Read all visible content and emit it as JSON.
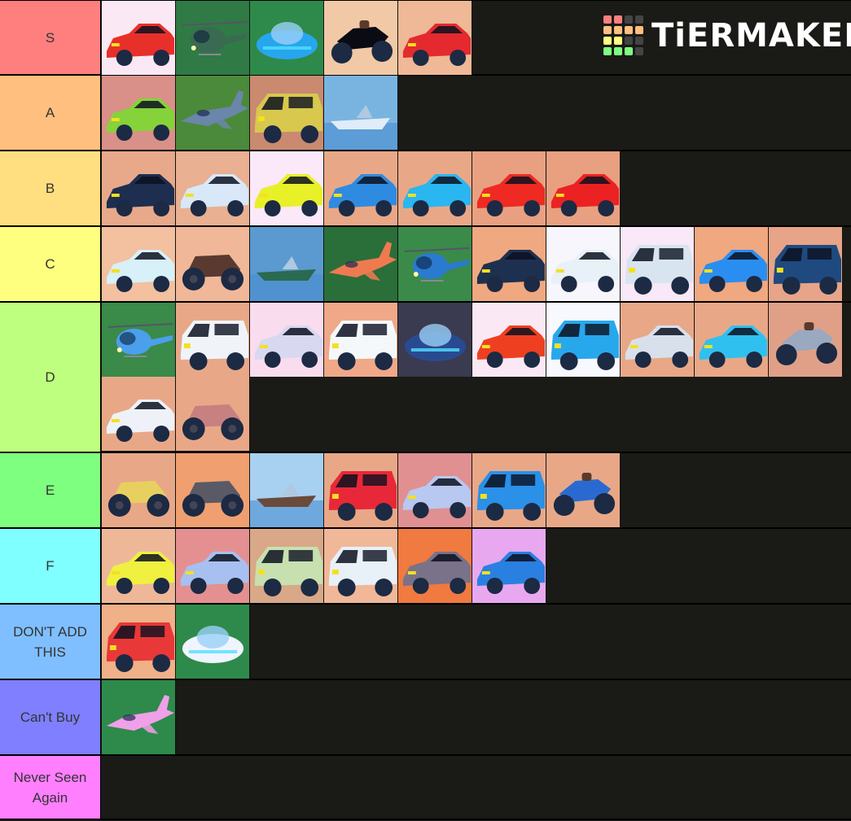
{
  "logo": {
    "text": "TiERMAKER",
    "grid_colors": [
      "#ff7f7f",
      "#ff7f7f",
      "#444444",
      "#444444",
      "#ffbf7f",
      "#ffbf7f",
      "#ffbf7f",
      "#ffbf7f",
      "#ffff7f",
      "#ffff7f",
      "#444444",
      "#444444",
      "#7fff7f",
      "#7fff7f",
      "#7fff7f",
      "#444444"
    ]
  },
  "tiers": [
    {
      "label": "S",
      "color": "#ff7f7f",
      "items": [
        {
          "name": "red-sports-car",
          "bg": "#fbe8f5",
          "body": "#e8302a",
          "kind": "car"
        },
        {
          "name": "military-helicopter",
          "bg": "#2f7a45",
          "body": "#3a6a52",
          "kind": "heli"
        },
        {
          "name": "blue-hover-vehicle",
          "bg": "#2e8a4a",
          "body": "#27a6ee",
          "kind": "hover"
        },
        {
          "name": "black-motorcycle",
          "bg": "#f2c9a6",
          "body": "#0b0b14",
          "kind": "bike"
        },
        {
          "name": "red-supercar",
          "bg": "#efb896",
          "body": "#e42a2e",
          "kind": "car"
        }
      ]
    },
    {
      "label": "A",
      "color": "#ffbf7f",
      "items": [
        {
          "name": "green-hypercar",
          "bg": "#d99088",
          "body": "#86d23a",
          "kind": "car"
        },
        {
          "name": "fighter-jet",
          "bg": "#4b8a3a",
          "body": "#6a86a8",
          "kind": "jet"
        },
        {
          "name": "yellow-suv",
          "bg": "#c98a70",
          "body": "#d8c84e",
          "kind": "suv"
        },
        {
          "name": "jet-ski",
          "bg": "#79b4e0",
          "body": "#e0ecf8",
          "kind": "boat"
        }
      ]
    },
    {
      "label": "B",
      "color": "#ffdf7f",
      "items": [
        {
          "name": "dark-blue-batmobile",
          "bg": "#e7a98a",
          "body": "#1e2e50",
          "kind": "car"
        },
        {
          "name": "classic-white-coupe",
          "bg": "#e9b092",
          "body": "#d8e8f8",
          "kind": "car"
        },
        {
          "name": "yellow-lamborghini",
          "bg": "#fbe8f8",
          "body": "#e8f028",
          "kind": "car"
        },
        {
          "name": "striped-blue-hypercar",
          "bg": "#e8a888",
          "body": "#2f8be0",
          "kind": "car"
        },
        {
          "name": "cyan-hypercar",
          "bg": "#e8a888",
          "body": "#2ab6f0",
          "kind": "car"
        },
        {
          "name": "red-ferrari",
          "bg": "#e8a080",
          "body": "#ee2a22",
          "kind": "car"
        },
        {
          "name": "red-muscle-coupe",
          "bg": "#e8a080",
          "body": "#ec2222",
          "kind": "car"
        }
      ]
    },
    {
      "label": "C",
      "color": "#ffff7f",
      "items": [
        {
          "name": "white-gullwing-supercar",
          "bg": "#f3c0a0",
          "body": "#d8f0f8",
          "kind": "car"
        },
        {
          "name": "dune-buggy",
          "bg": "#f0b898",
          "body": "#5a3a30",
          "kind": "buggy"
        },
        {
          "name": "speedboat",
          "bg": "#5a9ad0",
          "body": "#2a6a50",
          "kind": "boat"
        },
        {
          "name": "orange-propeller-plane",
          "bg": "#2a6e3a",
          "body": "#f07a50",
          "kind": "jet"
        },
        {
          "name": "small-blue-helicopter",
          "bg": "#3a8a4a",
          "body": "#2a7ad0",
          "kind": "heli"
        },
        {
          "name": "armored-sedan-turret",
          "bg": "#f0a880",
          "body": "#1e3050",
          "kind": "car"
        },
        {
          "name": "white-sports-sedan",
          "bg": "#f6f6fc",
          "body": "#e8f0f8",
          "kind": "car"
        },
        {
          "name": "cybertruck",
          "bg": "#f8e8f8",
          "body": "#d8e4f0",
          "kind": "suv"
        },
        {
          "name": "blue-tesla",
          "bg": "#f0a880",
          "body": "#2a8ef0",
          "kind": "car"
        },
        {
          "name": "swat-van-turret",
          "bg": "#e8a488",
          "body": "#1e4a80",
          "kind": "suv"
        }
      ]
    },
    {
      "label": "D",
      "color": "#bfff7f",
      "items": [
        {
          "name": "blue-helicopter",
          "bg": "#3a8a4a",
          "body": "#4aa0ea",
          "kind": "heli"
        },
        {
          "name": "police-suv",
          "bg": "#e8a888",
          "body": "#f0f4f8",
          "kind": "suv"
        },
        {
          "name": "delorean",
          "bg": "#fadcef",
          "body": "#d8d8f0",
          "kind": "car"
        },
        {
          "name": "ambulance",
          "bg": "#f0a888",
          "body": "#f4f8fa",
          "kind": "suv"
        },
        {
          "name": "ufo",
          "bg": "#3a3a50",
          "body": "#2a4a90",
          "kind": "hover"
        },
        {
          "name": "red-striped-sports-car",
          "bg": "#fbe8f5",
          "body": "#ee4020",
          "kind": "car"
        },
        {
          "name": "blue-striped-suv",
          "bg": "#f8f8ff",
          "body": "#28a8ec",
          "kind": "suv"
        },
        {
          "name": "vintage-roadster",
          "bg": "#e8a888",
          "body": "#d8e0ec",
          "kind": "car"
        },
        {
          "name": "cyan-muscle-car",
          "bg": "#e8a888",
          "body": "#30c0f0",
          "kind": "car"
        },
        {
          "name": "police-motorcycle",
          "bg": "#e0a088",
          "body": "#9aa8c0",
          "kind": "bike"
        },
        {
          "name": "white-audi",
          "bg": "#e8a888",
          "body": "#eef2f8",
          "kind": "car"
        },
        {
          "name": "rusty-buggy-frame",
          "bg": "#e8a888",
          "body": "#c88080",
          "kind": "buggy"
        }
      ]
    },
    {
      "label": "E",
      "color": "#7fff7f",
      "items": [
        {
          "name": "yellow-monster-truck",
          "bg": "#e8a888",
          "body": "#e8d060",
          "kind": "buggy"
        },
        {
          "name": "grey-atv",
          "bg": "#f0a070",
          "body": "#5a5a66",
          "kind": "buggy"
        },
        {
          "name": "sailing-ship",
          "bg": "#a8d0f0",
          "body": "#6a4a3a",
          "kind": "boat"
        },
        {
          "name": "red-mini-cooper",
          "bg": "#e8a888",
          "body": "#e82838",
          "kind": "suv"
        },
        {
          "name": "white-corvette",
          "bg": "#e09090",
          "body": "#b8c8f0",
          "kind": "car"
        },
        {
          "name": "blue-pickup-truck",
          "bg": "#e8a888",
          "body": "#2a90e8",
          "kind": "suv"
        },
        {
          "name": "blue-dirt-bike",
          "bg": "#e8a888",
          "body": "#2a6ad0",
          "kind": "bike"
        }
      ]
    },
    {
      "label": "F",
      "color": "#7fffff",
      "items": [
        {
          "name": "yellow-camaro",
          "bg": "#eeb898",
          "body": "#f0f040",
          "kind": "car"
        },
        {
          "name": "ae86-coupe",
          "bg": "#e49090",
          "body": "#a8c0f0",
          "kind": "car"
        },
        {
          "name": "green-jeep",
          "bg": "#d8a888",
          "body": "#c8e0b0",
          "kind": "suv"
        },
        {
          "name": "white-pickup",
          "bg": "#f0b898",
          "body": "#e8f0f8",
          "kind": "suv"
        },
        {
          "name": "grey-sports-car",
          "bg": "#f07a40",
          "body": "#7a7288",
          "kind": "car"
        },
        {
          "name": "blue-pink-sports-car",
          "bg": "#e8a8f0",
          "body": "#2a80e0",
          "kind": "car"
        }
      ]
    },
    {
      "label": "DON'T ADD THIS",
      "color": "#7fbfff",
      "items": [
        {
          "name": "fire-truck",
          "bg": "#f0b088",
          "body": "#e83838",
          "kind": "suv"
        },
        {
          "name": "white-rocket-pod",
          "bg": "#2e8a4a",
          "body": "#f0f4ff",
          "kind": "hover"
        }
      ]
    },
    {
      "label": "Can't Buy",
      "color": "#7f7fff",
      "items": [
        {
          "name": "pink-spaceship",
          "bg": "#2e8a4a",
          "body": "#f0a0e8",
          "kind": "jet"
        }
      ]
    },
    {
      "label": "Never Seen Again",
      "color": "#ff7fff",
      "items": []
    }
  ]
}
